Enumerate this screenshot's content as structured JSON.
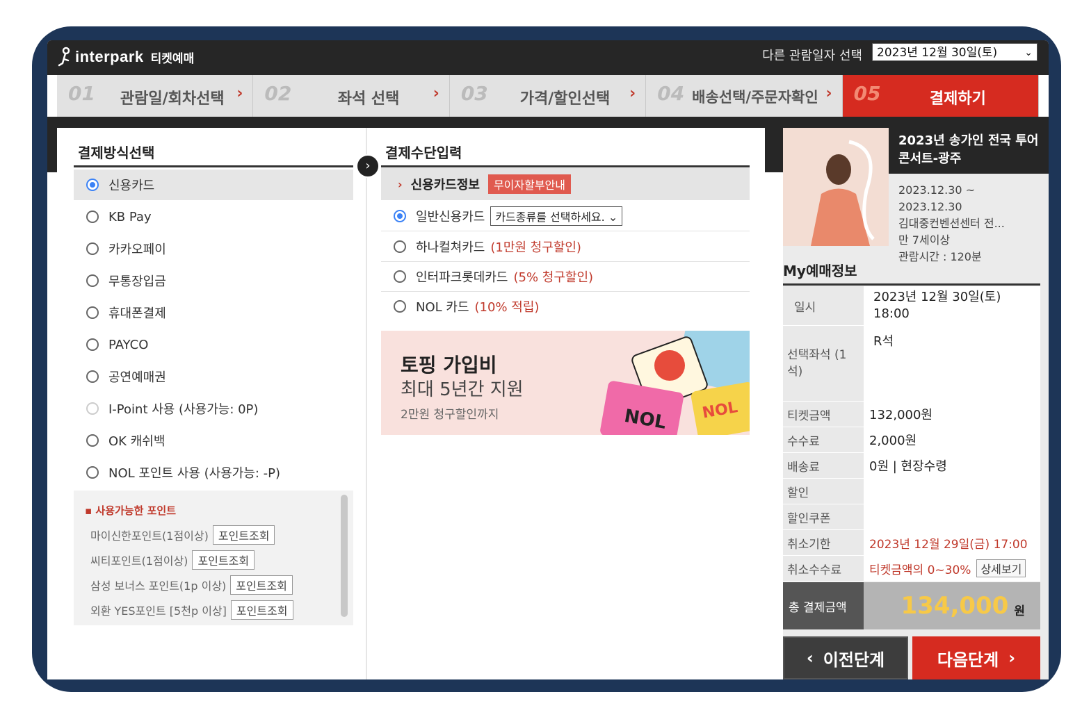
{
  "header": {
    "logo_text": "interpark",
    "logo_sub": "티켓예매",
    "date_label": "다른 관람일자 선택",
    "date_value": "2023년 12월 30일(토)"
  },
  "steps": [
    {
      "num": "01",
      "label": "관람일/회차선택"
    },
    {
      "num": "02",
      "label": "좌석 선택"
    },
    {
      "num": "03",
      "label": "가격/할인선택"
    },
    {
      "num": "04",
      "label": "배송선택/주문자확인"
    },
    {
      "num": "05",
      "label": "결제하기"
    }
  ],
  "payment_method": {
    "title": "결제방식선택",
    "options": [
      "신용카드",
      "KB Pay",
      "카카오페이",
      "무통장입금",
      "휴대폰결제",
      "PAYCO",
      "공연예매권",
      "I-Point 사용 (사용가능: 0P)",
      "OK 캐쉬백",
      "NOL 포인트 사용 (사용가능: -P)"
    ],
    "points_title": "사용가능한 포인트",
    "points": [
      {
        "label": "마이신한포인트(1점이상)",
        "button": "포인트조회"
      },
      {
        "label": "씨티포인트(1점이상)",
        "button": "포인트조회"
      },
      {
        "label": "삼성 보너스 포인트(1p 이상)",
        "button": "포인트조회"
      },
      {
        "label": "외환 YES포인트 [5천p 이상]",
        "button": "포인트조회"
      }
    ]
  },
  "payment_input": {
    "title": "결제수단입력",
    "card_info_label": "신용카드정보",
    "card_info_badge": "무이자할부안내",
    "general_card": "일반신용카드",
    "card_select_placeholder": "카드종류를 선택하세요.",
    "cards": [
      {
        "name": "하나컬쳐카드",
        "benefit": "(1만원 청구할인)"
      },
      {
        "name": "인터파크롯데카드",
        "benefit": "(5% 청구할인)"
      },
      {
        "name": "NOL 카드",
        "benefit": "(10% 적립)"
      }
    ],
    "banner": {
      "line1": "토핑 가입비",
      "line2": "최대 5년간 지원",
      "line3": "2만원 청구할인까지"
    }
  },
  "show": {
    "title": "2023년 송가인 전국 투어 콘서트-광주",
    "dates": "2023.12.30 ~",
    "dates_end": "2023.12.30",
    "venue": "김대중컨벤션센터 전...",
    "age": "만 7세이상",
    "runtime": "관람시간 : 120분"
  },
  "my_booking": {
    "title": "My예매정보",
    "rows": [
      {
        "k": "일시",
        "v": "2023년 12월 30일(토) 18:00"
      },
      {
        "k": "선택좌석 (1석)",
        "v": "R석"
      },
      {
        "k": "티켓금액",
        "v": "132,000원"
      },
      {
        "k": "수수료",
        "v": "2,000원"
      },
      {
        "k": "배송료",
        "v": "0원 | 현장수령"
      },
      {
        "k": "할인",
        "v": ""
      },
      {
        "k": "할인쿠폰",
        "v": ""
      },
      {
        "k": "취소기한",
        "v": "2023년 12월 29일(금) 17:00"
      },
      {
        "k": "취소수수료",
        "v": "티켓금액의 0~30%",
        "button": "상세보기"
      }
    ],
    "total_label": "총 결제금액",
    "total_amount": "134,000",
    "total_unit": "원"
  },
  "nav": {
    "prev": "이전단계",
    "next": "다음단계"
  },
  "colors": {
    "accent": "#d62b20",
    "selected_radio": "#3b82f6",
    "total": "#f7c948"
  }
}
